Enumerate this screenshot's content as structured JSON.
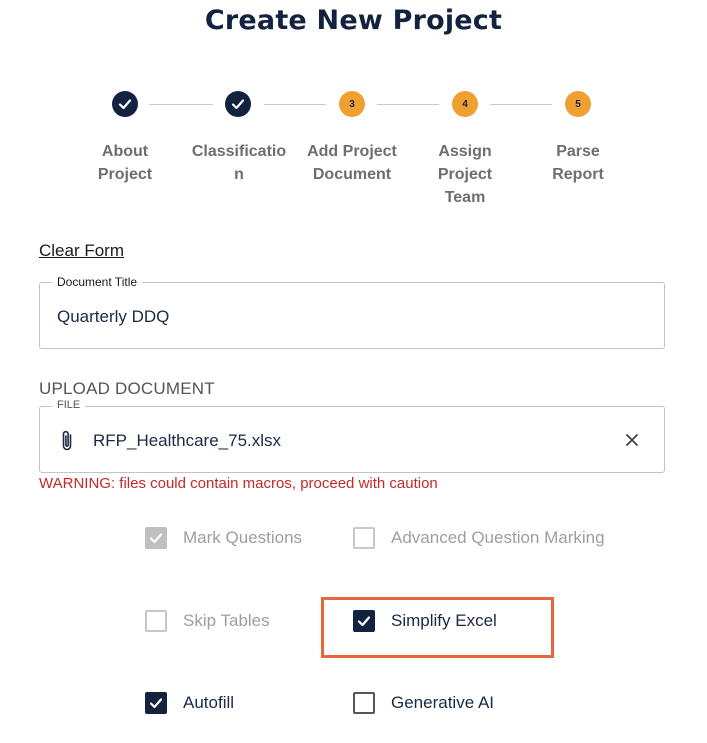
{
  "title": "Create New Project",
  "steps": [
    {
      "label_l1": "About",
      "label_l2": "Project",
      "label_l3": "",
      "status": "done",
      "number": "1"
    },
    {
      "label_l1": "Classificatio",
      "label_l2": "n",
      "label_l3": "",
      "status": "done",
      "number": "2"
    },
    {
      "label_l1": "Add Project",
      "label_l2": "Document",
      "label_l3": "",
      "status": "pending",
      "number": "3"
    },
    {
      "label_l1": "Assign",
      "label_l2": "Project",
      "label_l3": "Team",
      "status": "pending",
      "number": "4"
    },
    {
      "label_l1": "Parse",
      "label_l2": "Report",
      "label_l3": "",
      "status": "pending",
      "number": "5"
    }
  ],
  "clear_form": "Clear Form",
  "document_title": {
    "legend": "Document Title",
    "value": "Quarterly DDQ"
  },
  "upload": {
    "heading": "UPLOAD DOCUMENT",
    "legend": "FILE",
    "file_name": "RFP_Healthcare_75.xlsx",
    "clear_icon": "close-icon",
    "attach_icon": "paperclip-icon"
  },
  "warning": "WARNING: files could contain macros, proceed with caution",
  "options": {
    "mark_questions": {
      "label": "Mark Questions",
      "checked": true,
      "disabled": true
    },
    "advanced_marking": {
      "label": "Advanced Question Marking",
      "checked": false,
      "disabled": true
    },
    "skip_tables": {
      "label": "Skip Tables",
      "checked": false,
      "disabled": true
    },
    "simplify_excel": {
      "label": "Simplify Excel",
      "checked": true,
      "disabled": false
    },
    "autofill": {
      "label": "Autofill",
      "checked": true,
      "disabled": false
    },
    "generative_ai": {
      "label": "Generative AI",
      "checked": false,
      "disabled": false
    }
  },
  "colors": {
    "primary": "#13233f",
    "step_pending": "#f0a030",
    "warning": "#c62828",
    "highlight": "#e8663c"
  }
}
